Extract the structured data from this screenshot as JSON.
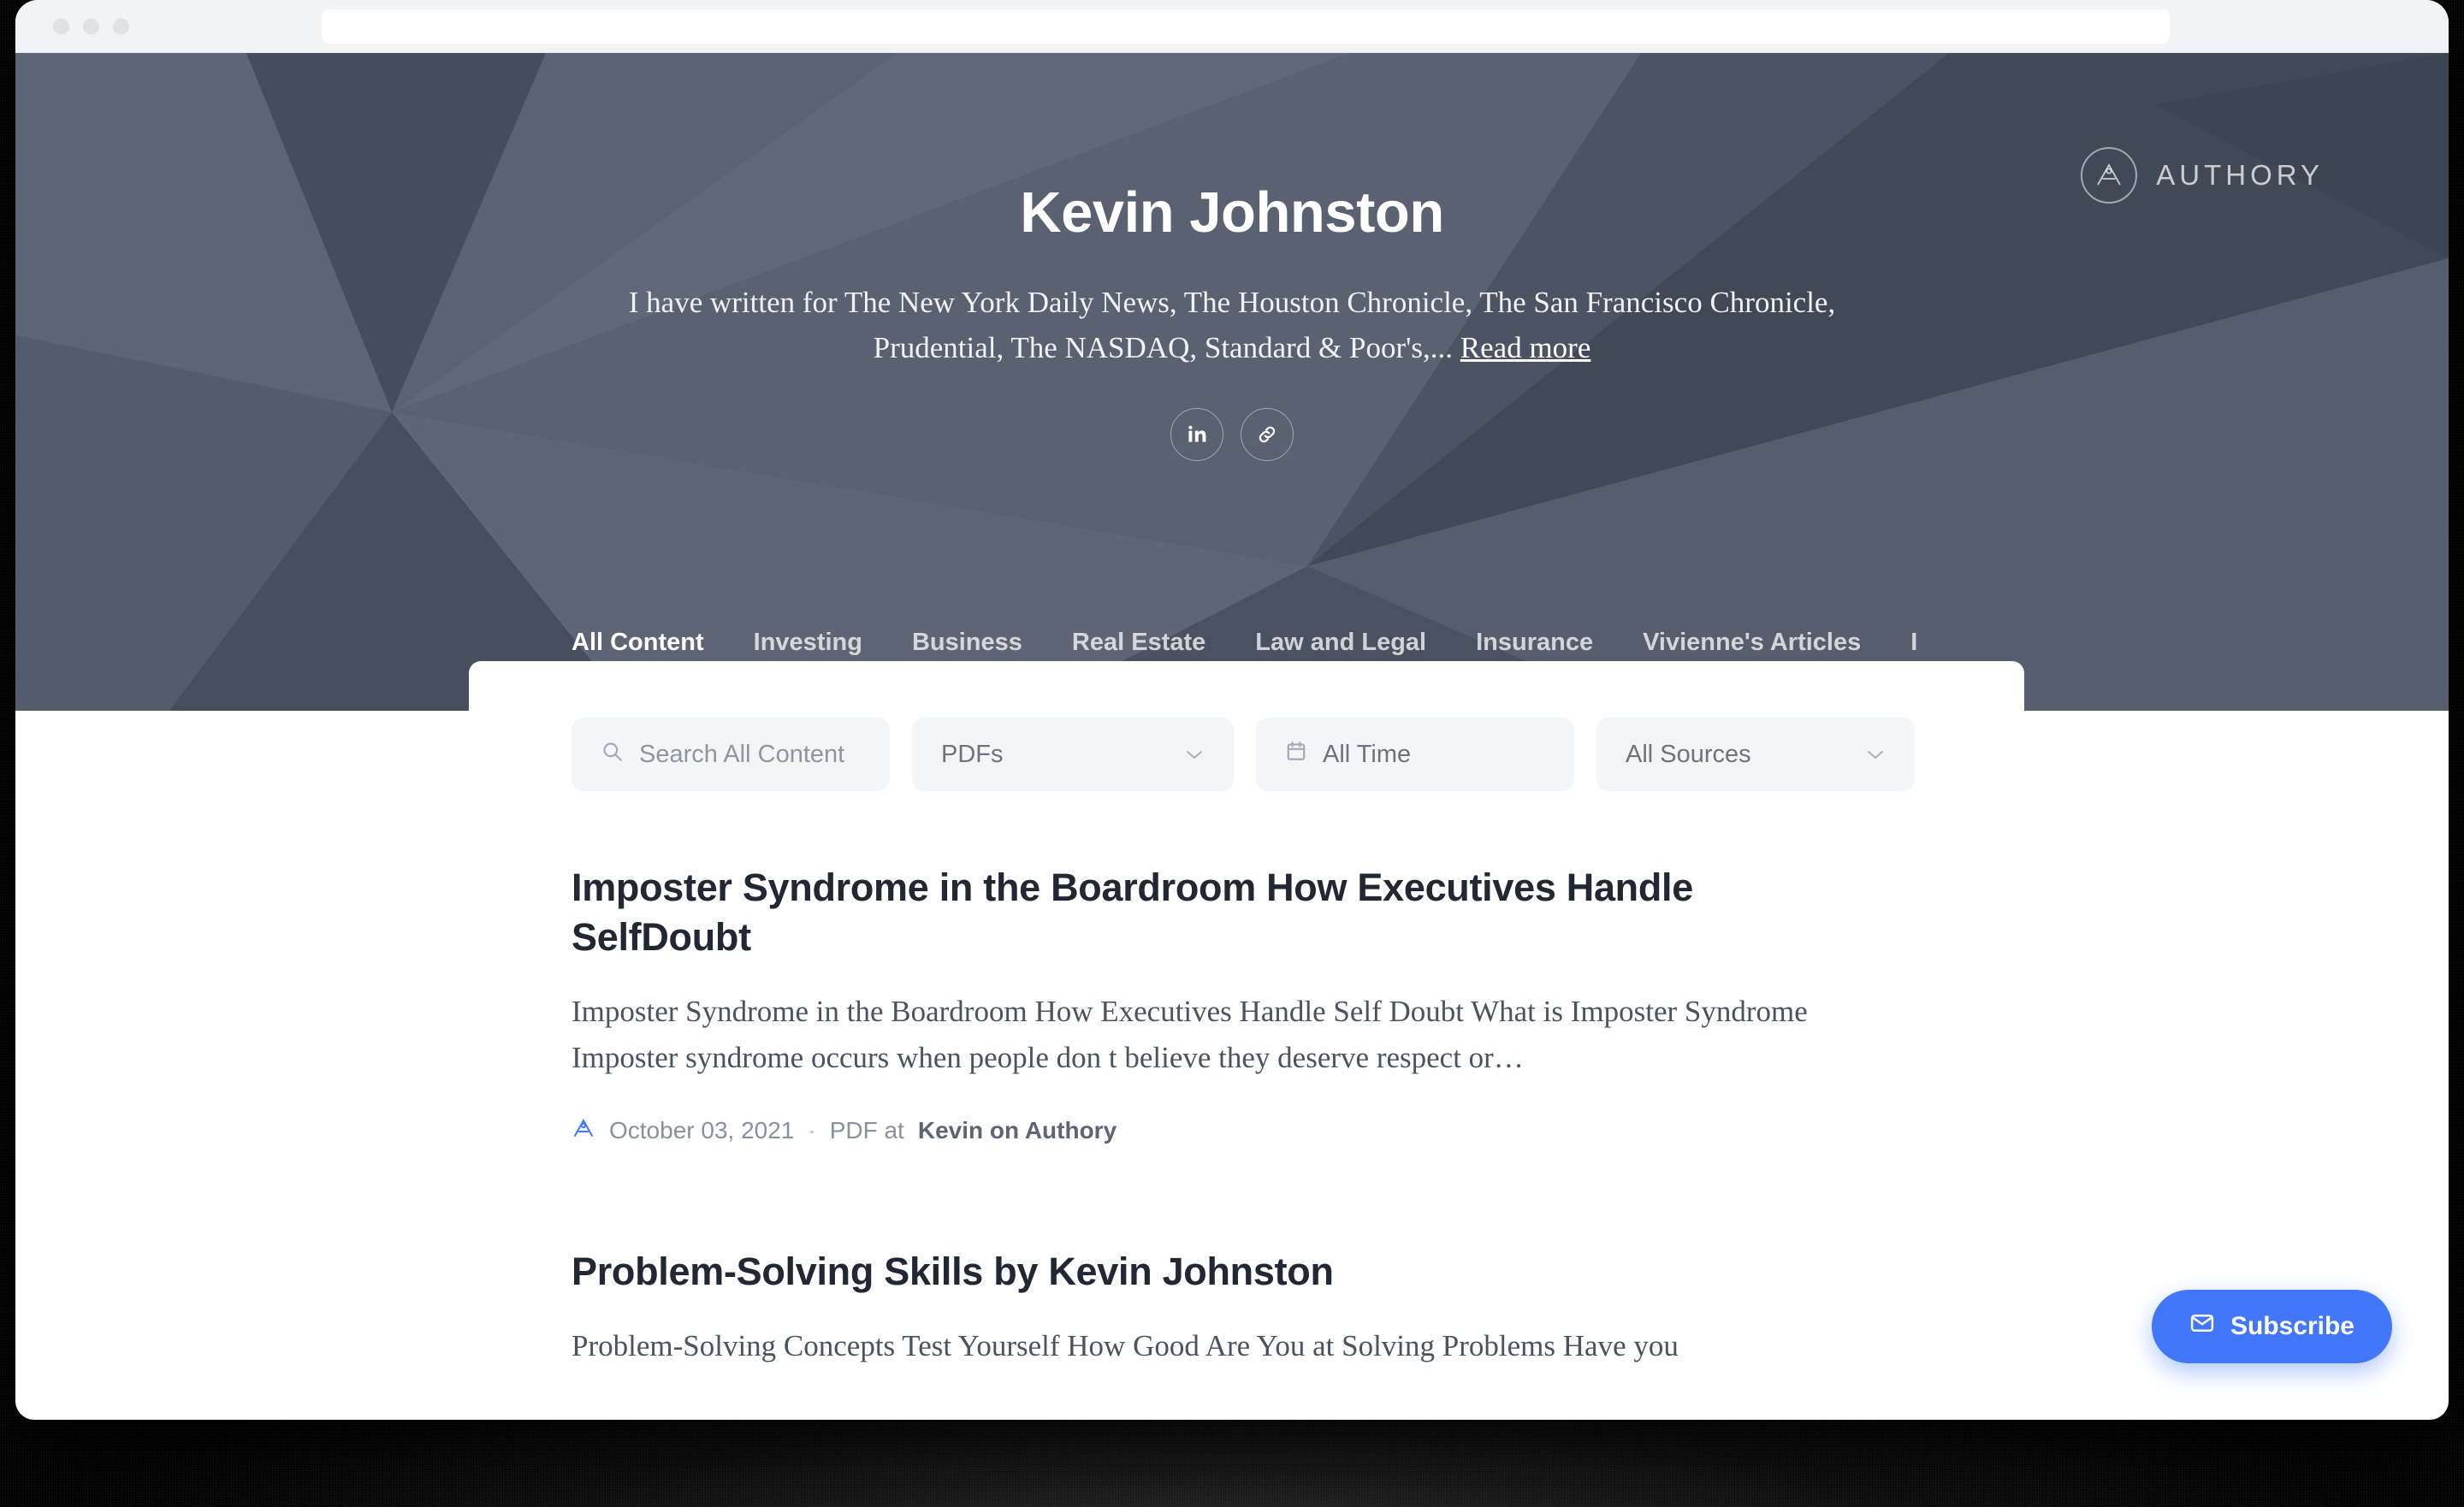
{
  "browser": {
    "traffic_lights": [
      "close",
      "minimize",
      "maximize"
    ],
    "url_value": "",
    "url_placeholder": ""
  },
  "brand": {
    "name": "AUTHORY",
    "logo_icon": "authory-compass-icon"
  },
  "hero": {
    "profile_name": "Kevin Johnston",
    "bio": "I have written for The New York Daily News, The Houston Chronicle, The San Francisco Chronicle, Prudential, The NASDAQ, Standard & Poor's,...",
    "read_more_label": "Read more",
    "socials": [
      {
        "name": "linkedin",
        "icon": "linkedin-icon",
        "glyph": "in"
      },
      {
        "name": "website",
        "icon": "link-icon",
        "glyph": "link"
      }
    ]
  },
  "tabs": {
    "active": "All Content",
    "items": [
      {
        "label": "All Content",
        "active": true
      },
      {
        "label": "Investing",
        "active": false
      },
      {
        "label": "Business",
        "active": false
      },
      {
        "label": "Real Estate",
        "active": false
      },
      {
        "label": "Law and Legal",
        "active": false
      },
      {
        "label": "Insurance",
        "active": false
      },
      {
        "label": "Vivienne's Articles",
        "active": false
      },
      {
        "label": "I",
        "active": false,
        "clipped": true
      }
    ]
  },
  "filters": {
    "search_placeholder": "Search All Content",
    "search_value": "",
    "search_icon": "search-icon",
    "type_value": "PDFs",
    "time_value": "All Time",
    "time_icon": "calendar-icon",
    "source_value": "All Sources",
    "chevron_icon": "chevron-down-icon"
  },
  "articles": [
    {
      "title": "Imposter Syndrome in the Boardroom How Executives Handle SelfDoubt",
      "excerpt": "Imposter Syndrome in the Boardroom How Executives Handle Self Doubt What is Imposter Syndrome Imposter syndrome occurs when people don t believe they deserve respect or…",
      "icon": "authory-a-icon",
      "date": "October 03, 2021",
      "separator": "·",
      "kind": "PDF at",
      "source": "Kevin on Authory"
    },
    {
      "title": "Problem-Solving Skills by Kevin Johnston",
      "excerpt": "Problem-Solving Concepts Test Yourself How Good Are You at Solving Problems Have you"
    }
  ],
  "subscribe": {
    "label": "Subscribe",
    "icon": "envelope-icon"
  },
  "colors": {
    "accent_blue": "#4277fa",
    "hero_base": "#545b6b",
    "hero_dark": "#3f4654",
    "card_bg": "#ffffff",
    "filter_bg": "#f4f5f7"
  }
}
